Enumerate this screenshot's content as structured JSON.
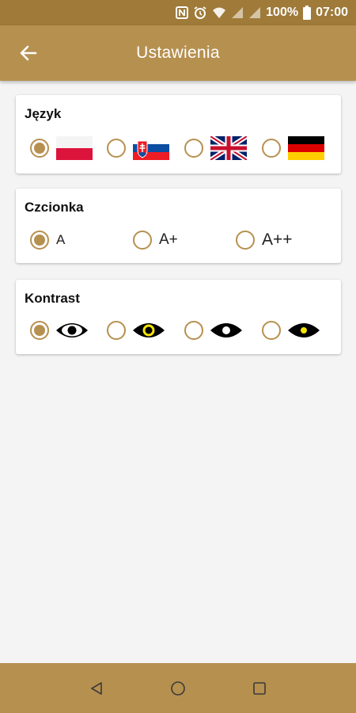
{
  "status_bar": {
    "battery": "100%",
    "time": "07:00",
    "icons": [
      "nfc-icon",
      "alarm-icon",
      "wifi-icon",
      "signal-icon",
      "signal-icon",
      "battery-icon"
    ]
  },
  "header": {
    "title": "Ustawienia",
    "back_icon": "arrow-left-icon"
  },
  "language": {
    "title": "Język",
    "selected": "pl",
    "options": [
      {
        "code": "pl",
        "icon": "flag-poland-icon",
        "selected": true
      },
      {
        "code": "sk",
        "icon": "flag-slovakia-icon",
        "selected": false
      },
      {
        "code": "en",
        "icon": "flag-uk-icon",
        "selected": false
      },
      {
        "code": "de",
        "icon": "flag-germany-icon",
        "selected": false
      }
    ]
  },
  "font": {
    "title": "Czcionka",
    "options": [
      {
        "label": "A",
        "selected": true
      },
      {
        "label": "A+",
        "selected": false
      },
      {
        "label": "A++",
        "selected": false
      }
    ]
  },
  "contrast": {
    "title": "Kontrast",
    "options": [
      {
        "icon": "eye-white-black-icon",
        "selected": true
      },
      {
        "icon": "eye-black-yellow-icon",
        "selected": false
      },
      {
        "icon": "eye-black-white-icon",
        "selected": false
      },
      {
        "icon": "eye-black-yellow-dot-icon",
        "selected": false
      }
    ]
  },
  "nav_bar": {
    "icons": [
      "back-triangle-icon",
      "home-circle-icon",
      "recents-square-icon"
    ]
  },
  "colors": {
    "accent": "#b6904f",
    "status_bar": "#9f7a39",
    "background": "#f4f4f4"
  }
}
